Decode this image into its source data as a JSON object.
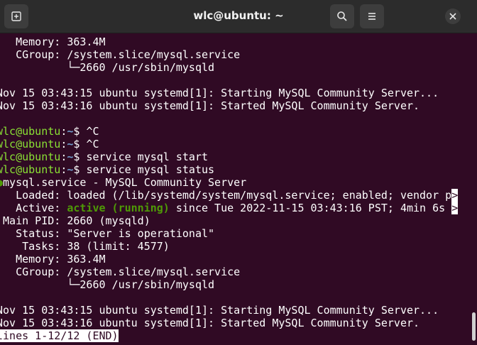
{
  "window": {
    "title": "wlc@ubuntu: ~"
  },
  "icons": {
    "new_tab": "new-tab-icon",
    "search": "search-icon",
    "menu": "hamburger-menu-icon",
    "close": "close-icon"
  },
  "terminal": {
    "user": "wlc@ubuntu",
    "sep": ":",
    "path": "~",
    "prompt_char": "$",
    "block1": {
      "memory": "   Memory: 363.4M",
      "cgroup": "   CGroup: /system.slice/mysql.service",
      "tree": "           └─2660 /usr/sbin/mysqld"
    },
    "log1": {
      "line1": "Nov 15 03:43:15 ubuntu systemd[1]: Starting MySQL Community Server...",
      "line2": "Nov 15 03:43:16 ubuntu systemd[1]: Started MySQL Community Server."
    },
    "commands": [
      "^C",
      "^C",
      "service mysql start",
      "service mysql status"
    ],
    "status": {
      "bullet": "●",
      "header": "mysql.service - MySQL Community Server",
      "loaded": "   Loaded: loaded (/lib/systemd/system/mysql.service; enabled; vendor p",
      "active_label": "   Active: ",
      "active_value": "active (running)",
      "active_rest": " since Tue 2022-11-15 03:43:16 PST; 4min 6s ",
      "more": ">",
      "main_pid": " Main PID: 2660 (mysqld)",
      "status_line": "   Status: \"Server is operational\"",
      "tasks": "    Tasks: 38 (limit: 4577)",
      "memory": "   Memory: 363.4M",
      "cgroup": "   CGroup: /system.slice/mysql.service",
      "tree": "           └─2660 /usr/sbin/mysqld"
    },
    "log2": {
      "line1": "Nov 15 03:43:15 ubuntu systemd[1]: Starting MySQL Community Server...",
      "line2": "Nov 15 03:43:16 ubuntu systemd[1]: Started MySQL Community Server."
    },
    "pager_status": "lines 1-12/12 (END)"
  },
  "colors": {
    "background": "#300a24",
    "titlebar": "#2c2c2c",
    "prompt_user": "#8ae234",
    "prompt_path": "#729fcf",
    "active_green": "#4e9a06"
  }
}
